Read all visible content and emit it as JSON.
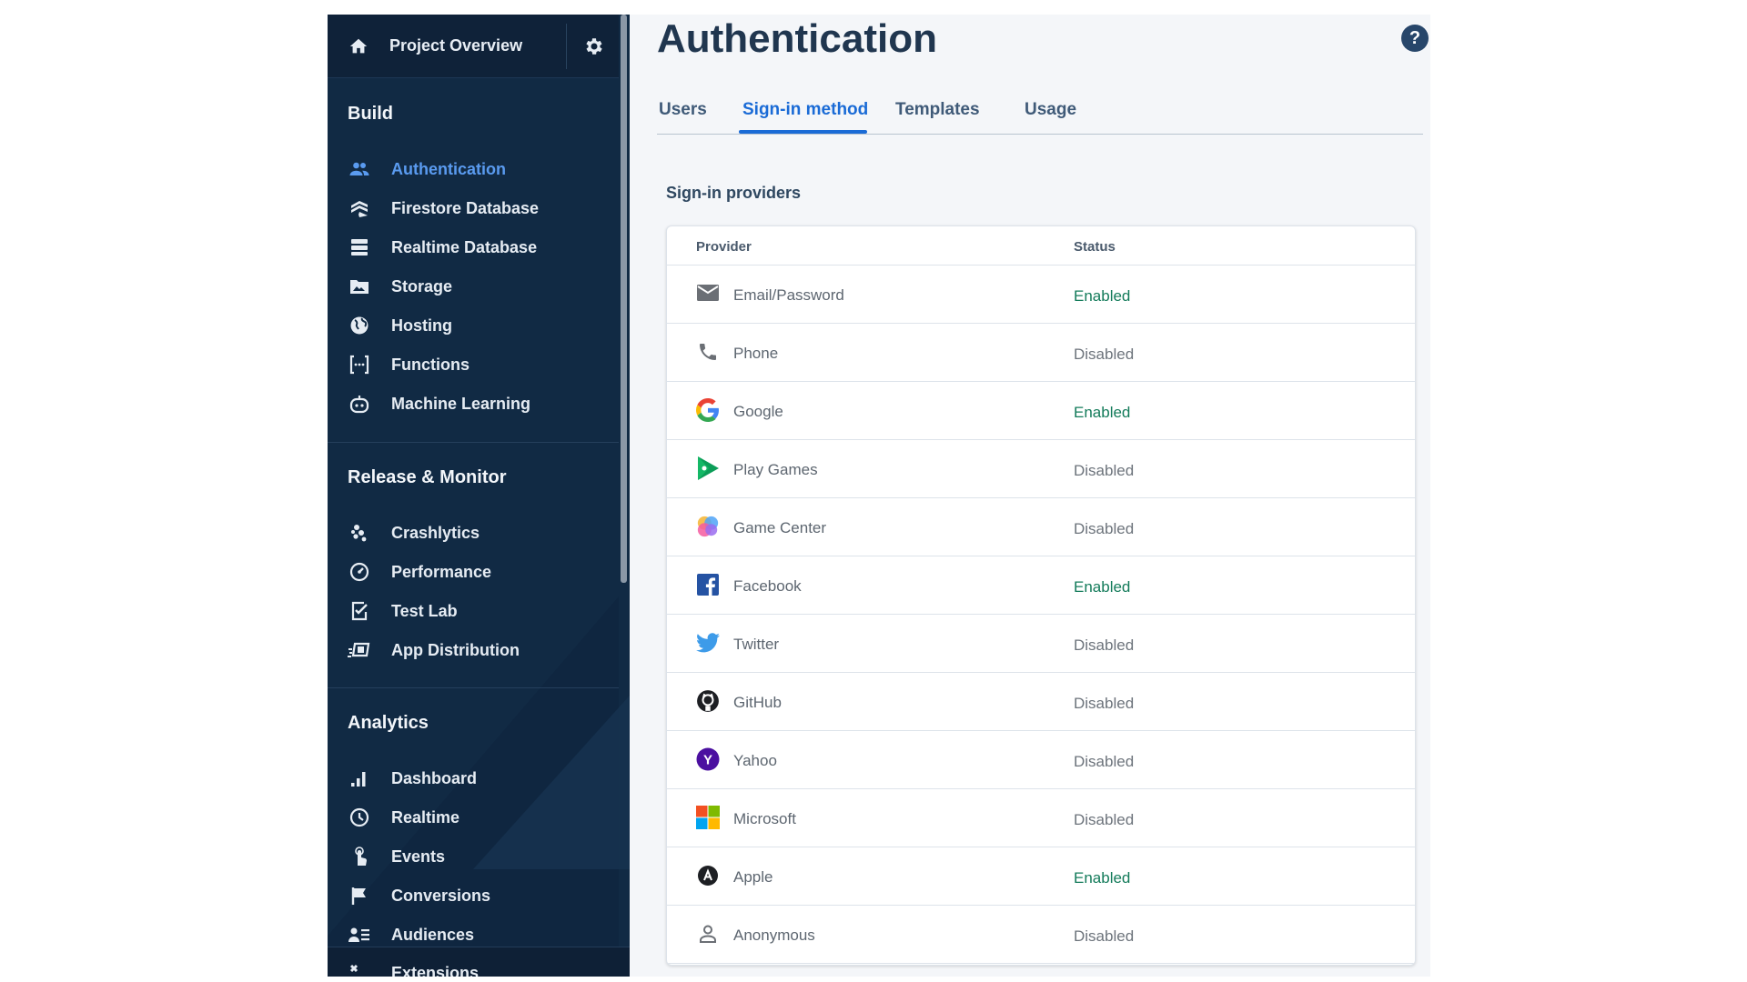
{
  "sidebar": {
    "project_title": "Project Overview",
    "sections": [
      {
        "title": "Build",
        "items": [
          {
            "label": "Authentication",
            "icon": "people-icon",
            "active": true
          },
          {
            "label": "Firestore Database",
            "icon": "firestore-icon"
          },
          {
            "label": "Realtime Database",
            "icon": "database-icon"
          },
          {
            "label": "Storage",
            "icon": "folder-image-icon"
          },
          {
            "label": "Hosting",
            "icon": "globe-icon"
          },
          {
            "label": "Functions",
            "icon": "functions-icon"
          },
          {
            "label": "Machine Learning",
            "icon": "robot-icon"
          }
        ]
      },
      {
        "title": "Release & Monitor",
        "items": [
          {
            "label": "Crashlytics",
            "icon": "crashlytics-icon"
          },
          {
            "label": "Performance",
            "icon": "speedometer-icon"
          },
          {
            "label": "Test Lab",
            "icon": "checklist-icon"
          },
          {
            "label": "App Distribution",
            "icon": "app-distribution-icon"
          }
        ]
      },
      {
        "title": "Analytics",
        "items": [
          {
            "label": "Dashboard",
            "icon": "bar-chart-icon"
          },
          {
            "label": "Realtime",
            "icon": "clock-icon"
          },
          {
            "label": "Events",
            "icon": "touch-icon"
          },
          {
            "label": "Conversions",
            "icon": "flag-icon"
          },
          {
            "label": "Audiences",
            "icon": "audience-icon"
          }
        ]
      }
    ],
    "footer_item": "Extensions"
  },
  "main": {
    "title": "Authentication",
    "tabs": [
      "Users",
      "Sign-in method",
      "Templates",
      "Usage"
    ],
    "active_tab": "Sign-in method",
    "section_label": "Sign-in providers",
    "table": {
      "headers": [
        "Provider",
        "Status"
      ],
      "rows": [
        {
          "provider": "Email/Password",
          "status": "Enabled",
          "icon": "email-icon"
        },
        {
          "provider": "Phone",
          "status": "Disabled",
          "icon": "phone-icon"
        },
        {
          "provider": "Google",
          "status": "Enabled",
          "icon": "google-icon"
        },
        {
          "provider": "Play Games",
          "status": "Disabled",
          "icon": "play-games-icon"
        },
        {
          "provider": "Game Center",
          "status": "Disabled",
          "icon": "game-center-icon"
        },
        {
          "provider": "Facebook",
          "status": "Enabled",
          "icon": "facebook-icon"
        },
        {
          "provider": "Twitter",
          "status": "Disabled",
          "icon": "twitter-icon"
        },
        {
          "provider": "GitHub",
          "status": "Disabled",
          "icon": "github-icon"
        },
        {
          "provider": "Yahoo",
          "status": "Disabled",
          "icon": "yahoo-icon"
        },
        {
          "provider": "Microsoft",
          "status": "Disabled",
          "icon": "microsoft-icon"
        },
        {
          "provider": "Apple",
          "status": "Enabled",
          "icon": "apple-icon"
        },
        {
          "provider": "Anonymous",
          "status": "Disabled",
          "icon": "anonymous-icon"
        }
      ]
    }
  },
  "colors": {
    "sidebar_bg": "#112a44",
    "active_nav": "#5a9bf0",
    "tab_active": "#1a6bd6",
    "enabled": "#137b5a",
    "disabled": "#6c737b"
  }
}
